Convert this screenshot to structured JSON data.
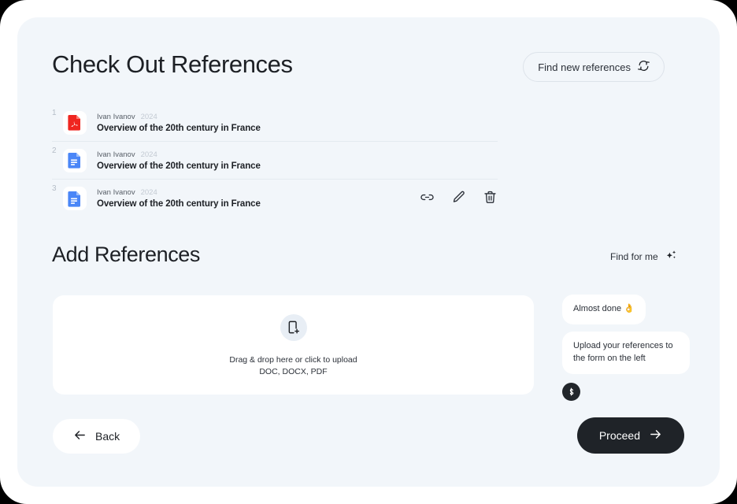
{
  "header": {
    "title": "Check Out References",
    "find_new_button": {
      "label": "Find new references",
      "icon": "refresh-icon"
    }
  },
  "references": {
    "rows": [
      {
        "index": "1",
        "file_type": "pdf",
        "icon": "pdf-file-icon",
        "author": "Ivan Ivanov",
        "year": "2024",
        "title": "Overview of the 20th century in France",
        "actions_visible": false
      },
      {
        "index": "2",
        "file_type": "doc",
        "icon": "doc-file-icon",
        "author": "Ivan Ivanov",
        "year": "2024",
        "title": "Overview of the 20th century in France",
        "actions_visible": false
      },
      {
        "index": "3",
        "file_type": "doc",
        "icon": "doc-file-icon",
        "author": "Ivan Ivanov",
        "year": "2024",
        "title": "Overview of the 20th century in France",
        "actions_visible": true
      }
    ],
    "actions": [
      {
        "name": "link-icon",
        "tooltip": "Link"
      },
      {
        "name": "edit-pencil-icon",
        "tooltip": "Edit"
      },
      {
        "name": "trash-icon",
        "tooltip": "Delete"
      }
    ]
  },
  "add_section": {
    "title": "Add References",
    "find_for_me": {
      "label": "Find for me",
      "icon": "sparkles-icon"
    }
  },
  "dropzone": {
    "icon": "file-plus-icon",
    "line1": "Drag & drop here or click to upload",
    "line2": "DOC, DOCX, PDF"
  },
  "assistant": {
    "messages": [
      "Almost done 👌",
      "Upload your references to the form on the left"
    ],
    "avatar_icon": "assistant-avatar-icon"
  },
  "footer": {
    "back": {
      "label": "Back",
      "icon": "arrow-left-icon"
    },
    "proceed": {
      "label": "Proceed",
      "icon": "arrow-right-icon"
    }
  },
  "colors": {
    "panel_bg": "#f2f6fa",
    "frame_bg": "#ffffff",
    "text_primary": "#1d2025",
    "text_muted": "#c3cad3",
    "pdf_red": "#ef2620",
    "doc_blue": "#4a86f7",
    "proceed_dark": "#1f2328"
  }
}
